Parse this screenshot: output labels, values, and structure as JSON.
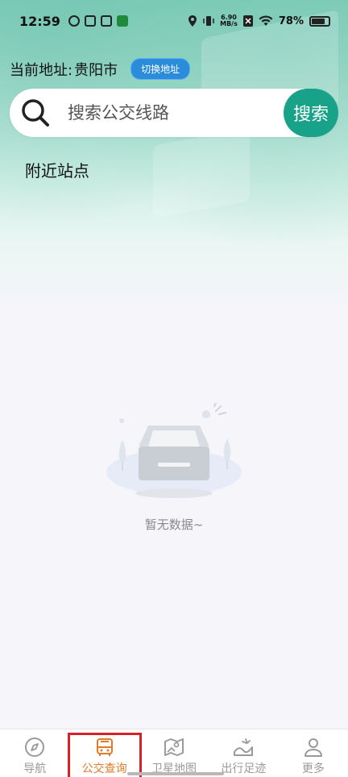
{
  "status_bar": {
    "time": "12:59",
    "speed_value": "6.90",
    "speed_unit": "MB/s",
    "battery": "78%"
  },
  "header": {
    "address_label": "当前地址:",
    "city": "贵阳市",
    "switch_button": "切换地址"
  },
  "search": {
    "placeholder": "搜索公交线路",
    "button_label": "搜索"
  },
  "nearby": {
    "title": "附近站点",
    "empty_text": "暂无数据~"
  },
  "tabbar": {
    "items": [
      {
        "label": "导航",
        "icon": "compass-icon"
      },
      {
        "label": "公交查询",
        "icon": "bus-icon"
      },
      {
        "label": "卫星地图",
        "icon": "map-icon"
      },
      {
        "label": "出行足迹",
        "icon": "footprint-icon"
      },
      {
        "label": "更多",
        "icon": "user-icon"
      }
    ],
    "active_index": 1
  },
  "colors": {
    "accent": "#19a28a",
    "active_tab": "#e27a28",
    "switch_button": "#2b8cdc"
  }
}
